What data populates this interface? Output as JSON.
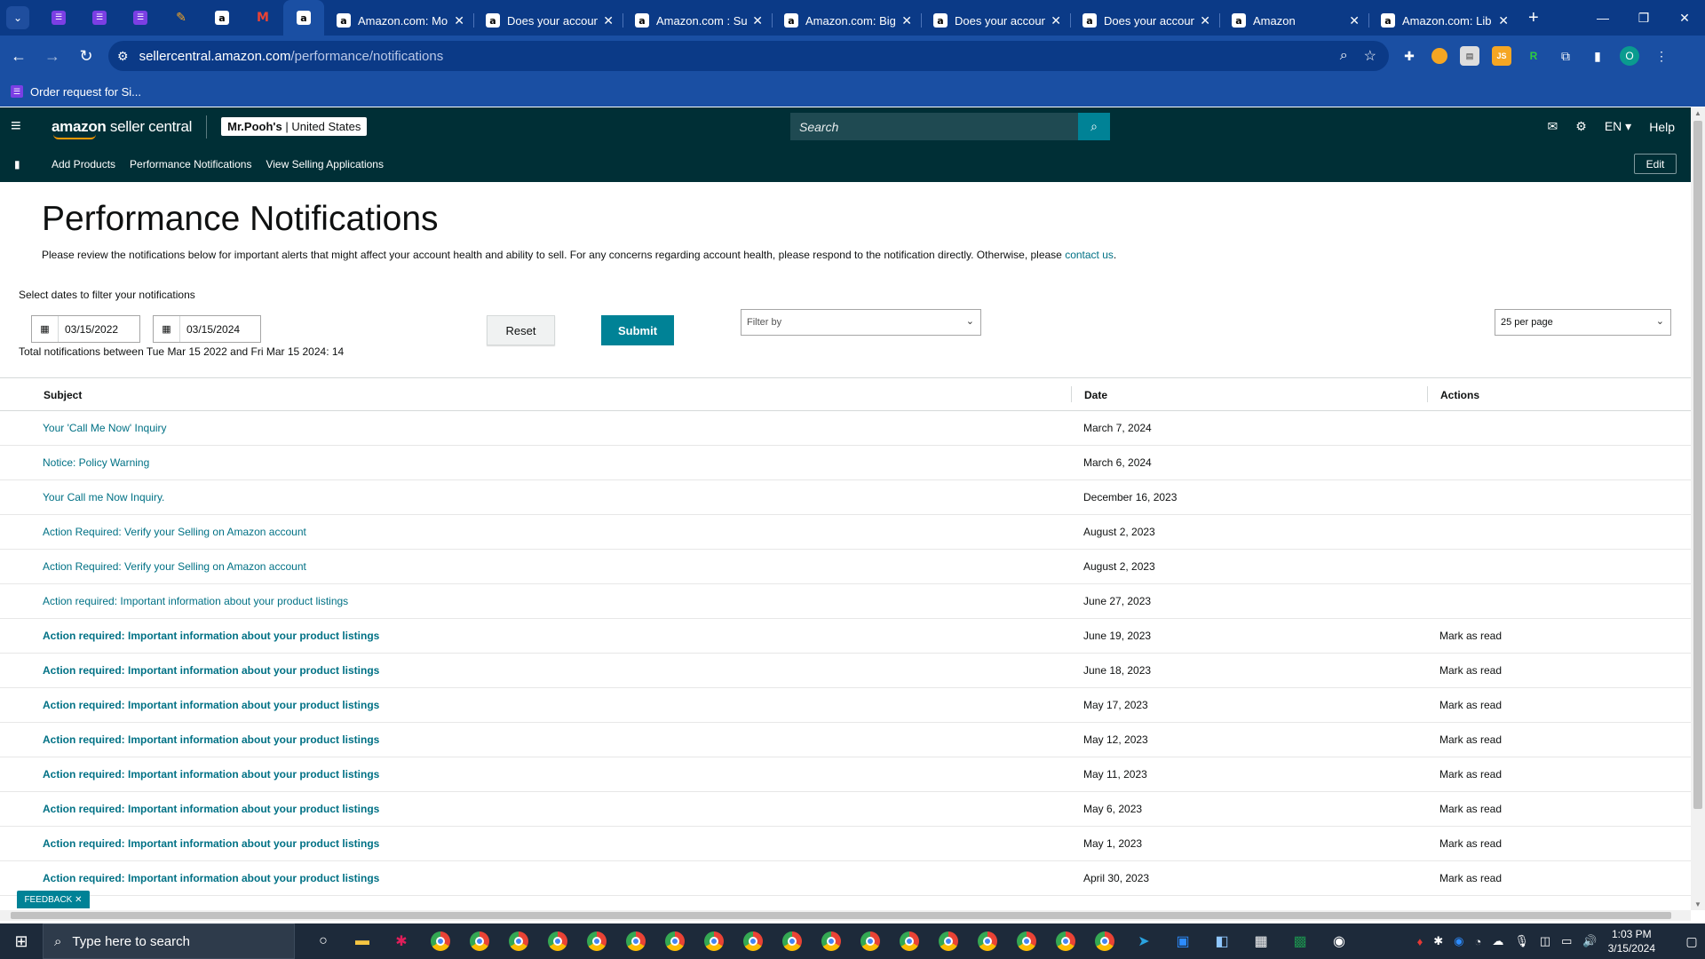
{
  "browser": {
    "tabs": [
      {
        "title": "Amazon.com: Mo"
      },
      {
        "title": "Does your accoun"
      },
      {
        "title": "Amazon.com : Su"
      },
      {
        "title": "Amazon.com: Big"
      },
      {
        "title": "Does your accoun"
      },
      {
        "title": "Does your accoun"
      },
      {
        "title": "Amazon"
      },
      {
        "title": "Amazon.com: Lib"
      }
    ],
    "url_host": "sellercentral.amazon.com",
    "url_path": "/performance/notifications",
    "bookmark": "Order request for Si...",
    "profile_initial": "O"
  },
  "header": {
    "logo_bold": "amazon",
    "logo_rest": " seller central",
    "store_name": "Mr.Pooh's",
    "store_region": " | United States",
    "search_placeholder": "Search",
    "language": "EN",
    "help": "Help"
  },
  "nav": {
    "links": [
      "Add Products",
      "Performance Notifications",
      "View Selling Applications"
    ],
    "edit": "Edit"
  },
  "page": {
    "title": "Performance Notifications",
    "description": "Please review the notifications below for important alerts that might affect your account health and ability to sell. For any concerns regarding account health, please respond to the notification directly. Otherwise, please ",
    "contact_link": "contact us",
    "description_end": ".",
    "filter_label": "Select dates to filter your notifications",
    "start_date": "03/15/2022",
    "end_date": "03/15/2024",
    "reset": "Reset",
    "submit": "Submit",
    "filter_placeholder": "Filter by",
    "per_page": "25 per page",
    "total_text": "Total notifications between Tue Mar 15 2022 and Fri Mar 15 2024: 14"
  },
  "table": {
    "headers": {
      "subject": "Subject",
      "date": "Date",
      "actions": "Actions"
    },
    "rows": [
      {
        "subject": "Your 'Call Me Now' Inquiry",
        "date": "March 7, 2024",
        "action": "",
        "unread": false
      },
      {
        "subject": "Notice: Policy Warning",
        "date": "March 6, 2024",
        "action": "",
        "unread": false
      },
      {
        "subject": "Your Call me Now Inquiry.",
        "date": "December 16, 2023",
        "action": "",
        "unread": false
      },
      {
        "subject": "Action Required: Verify your Selling on Amazon account",
        "date": "August 2, 2023",
        "action": "",
        "unread": false
      },
      {
        "subject": "Action Required: Verify your Selling on Amazon account",
        "date": "August 2, 2023",
        "action": "",
        "unread": false
      },
      {
        "subject": "Action required: Important information about your product listings",
        "date": "June 27, 2023",
        "action": "",
        "unread": false
      },
      {
        "subject": "Action required: Important information about your product listings",
        "date": "June 19, 2023",
        "action": "Mark as read",
        "unread": true
      },
      {
        "subject": "Action required: Important information about your product listings",
        "date": "June 18, 2023",
        "action": "Mark as read",
        "unread": true
      },
      {
        "subject": "Action required: Important information about your product listings",
        "date": "May 17, 2023",
        "action": "Mark as read",
        "unread": true
      },
      {
        "subject": "Action required: Important information about your product listings",
        "date": "May 12, 2023",
        "action": "Mark as read",
        "unread": true
      },
      {
        "subject": "Action required: Important information about your product listings",
        "date": "May 11, 2023",
        "action": "Mark as read",
        "unread": true
      },
      {
        "subject": "Action required: Important information about your product listings",
        "date": "May 6, 2023",
        "action": "Mark as read",
        "unread": true
      },
      {
        "subject": "Action required: Important information about your product listings",
        "date": "May 1, 2023",
        "action": "Mark as read",
        "unread": true
      },
      {
        "subject": "Action required: Important information about your product listings",
        "date": "April 30, 2023",
        "action": "Mark as read",
        "unread": true
      }
    ]
  },
  "feedback": "FEEDBACK",
  "taskbar": {
    "search_placeholder": "Type here to search",
    "time": "1:03 PM",
    "date": "3/15/2024"
  },
  "colors": {
    "header_bg": "#002f36",
    "link": "#007185",
    "accent": "#008296",
    "browser_frame": "#1a4fa3"
  }
}
